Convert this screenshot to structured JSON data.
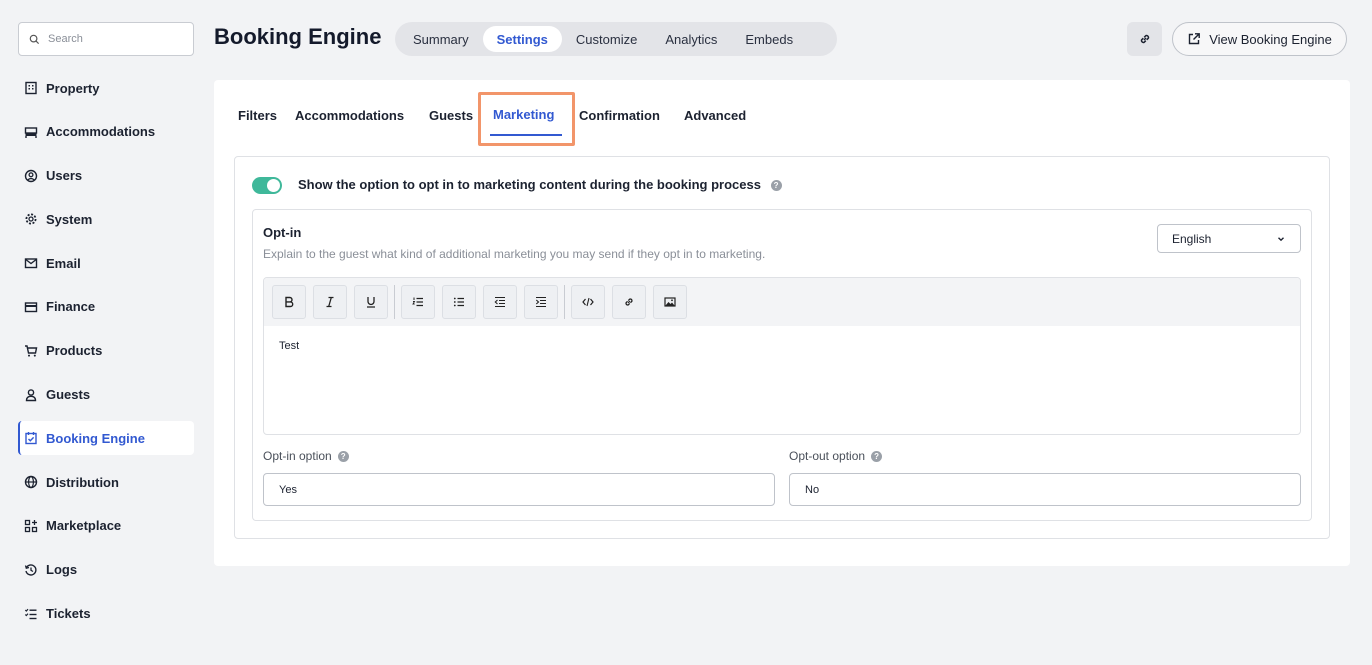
{
  "search": {
    "placeholder": "Search"
  },
  "sidebar": {
    "items": [
      {
        "label": "Property",
        "icon": "building-icon"
      },
      {
        "label": "Accommodations",
        "icon": "bed-icon"
      },
      {
        "label": "Users",
        "icon": "user-circle-icon"
      },
      {
        "label": "System",
        "icon": "gear-icon"
      },
      {
        "label": "Email",
        "icon": "envelope-icon"
      },
      {
        "label": "Finance",
        "icon": "credit-card-icon"
      },
      {
        "label": "Products",
        "icon": "cart-icon"
      },
      {
        "label": "Guests",
        "icon": "person-icon"
      },
      {
        "label": "Booking Engine",
        "icon": "calendar-check-icon",
        "active": true
      },
      {
        "label": "Distribution",
        "icon": "globe-icon"
      },
      {
        "label": "Marketplace",
        "icon": "grid-plus-icon"
      },
      {
        "label": "Logs",
        "icon": "history-icon"
      },
      {
        "label": "Tickets",
        "icon": "checklist-icon"
      }
    ]
  },
  "header": {
    "title": "Booking Engine",
    "tabs": [
      "Summary",
      "Settings",
      "Customize",
      "Analytics",
      "Embeds"
    ],
    "active_tab": "Settings",
    "view_button": "View Booking Engine"
  },
  "sub_tabs": {
    "items": [
      "Filters",
      "Accommodations",
      "Guests",
      "Marketing",
      "Confirmation",
      "Advanced"
    ],
    "active": "Marketing"
  },
  "marketing": {
    "toggle_label": "Show the option to opt in to marketing content during the booking process",
    "toggle_on": true,
    "optin_title": "Opt-in",
    "optin_description": "Explain to the guest what kind of additional marketing you may send if they opt in to marketing.",
    "language": "English",
    "editor_content": "Test",
    "optin_option_label": "Opt-in option",
    "optin_option_value": "Yes",
    "optout_option_label": "Opt-out option",
    "optout_option_value": "No"
  },
  "colors": {
    "accent": "#3259d1",
    "toggle": "#3fb89a",
    "highlight": "#f2956a"
  }
}
